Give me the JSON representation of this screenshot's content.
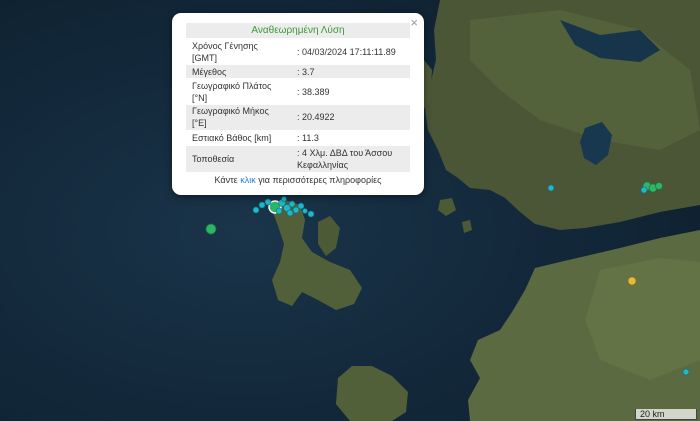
{
  "popup": {
    "title": "Αναθεωρημένη Λύση",
    "close_symbol": "×",
    "rows": [
      {
        "label_lines": [
          "Χρόνος Γένησης",
          "[GMT]"
        ],
        "value_lines": [
          ":",
          "04/03/2024 17:11:11.89"
        ]
      },
      {
        "label_lines": [
          "Μέγεθος"
        ],
        "value_lines": [
          ":",
          "3.7"
        ]
      },
      {
        "label_lines": [
          "Γεωγραφικό Πλάτος",
          "[°N]"
        ],
        "value_lines": [
          ":",
          "38.389"
        ]
      },
      {
        "label_lines": [
          "Γεωγραφικό Μήκος",
          "[°E]"
        ],
        "value_lines": [
          ":",
          "20.4922"
        ]
      },
      {
        "label_lines": [
          "Εστιακό Βάθος [km]"
        ],
        "value_lines": [
          ":",
          "11.3"
        ]
      },
      {
        "label_lines": [
          "Τοποθεσία"
        ],
        "value_lines": [
          ":",
          "4 Χλμ. ΔΒΔ του Άσσου Κεφαλληνίας"
        ]
      }
    ],
    "footer": {
      "before": "Κάντε",
      "link": "κλικ",
      "after": "για περισσότερες πληροφορίες"
    }
  },
  "scale_bar": {
    "label": "20 km"
  },
  "colors": {
    "sea": "#132a3d",
    "land": "#4a5636",
    "quake_cyan": "#1fb8c9",
    "quake_green": "#2fb56a",
    "quake_yellow": "#e6b93c",
    "popup_title": "#3a9a3a",
    "link": "#2a7fd4"
  }
}
